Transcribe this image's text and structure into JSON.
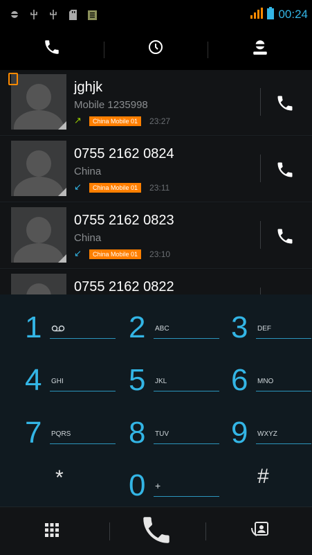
{
  "status_bar": {
    "time": "00:24",
    "left_icons": [
      "android-debug-icon",
      "usb-icon",
      "usb-icon",
      "sd-card-icon",
      "clipboard-icon"
    ],
    "right_icons": [
      "signal-icon",
      "battery-icon"
    ],
    "signal_color": "#ff8a00",
    "battery_color": "#33b5e5"
  },
  "tabs": [
    {
      "icon": "phone-icon",
      "selected": true
    },
    {
      "icon": "clock-icon",
      "selected": false
    },
    {
      "icon": "contact-icon",
      "selected": false
    }
  ],
  "call_log": [
    {
      "name": "jghjk",
      "detail": "Mobile 1235998",
      "direction": "outgoing",
      "sim": "China Mobile 01",
      "time": "23:27",
      "has_sim_badge": true
    },
    {
      "name": "0755 2162 0824",
      "detail": "China",
      "direction": "incoming",
      "sim": "China Mobile 01",
      "time": "23:11"
    },
    {
      "name": "0755 2162 0823",
      "detail": "China",
      "direction": "incoming",
      "sim": "China Mobile 01",
      "time": "23:10"
    },
    {
      "name": "0755 2162 0822",
      "detail": "",
      "direction": "",
      "sim": "",
      "time": ""
    }
  ],
  "dialpad": [
    {
      "digit": "1",
      "letters": "ꝏ"
    },
    {
      "digit": "2",
      "letters": "ABC"
    },
    {
      "digit": "3",
      "letters": "DEF"
    },
    {
      "digit": "4",
      "letters": "GHI"
    },
    {
      "digit": "5",
      "letters": "JKL"
    },
    {
      "digit": "6",
      "letters": "MNO"
    },
    {
      "digit": "7",
      "letters": "PQRS"
    },
    {
      "digit": "8",
      "letters": "TUV"
    },
    {
      "digit": "9",
      "letters": "WXYZ"
    },
    {
      "digit": "0",
      "letters": "+"
    }
  ],
  "star": "*",
  "hash": "#",
  "bottom_bar": [
    "dialpad-toggle-icon",
    "dial-call-icon",
    "contacts-icon"
  ],
  "colors": {
    "accent": "#33b5e5",
    "sim_badge": "#ff7f00",
    "outgoing_arrow": "#99cc00"
  }
}
